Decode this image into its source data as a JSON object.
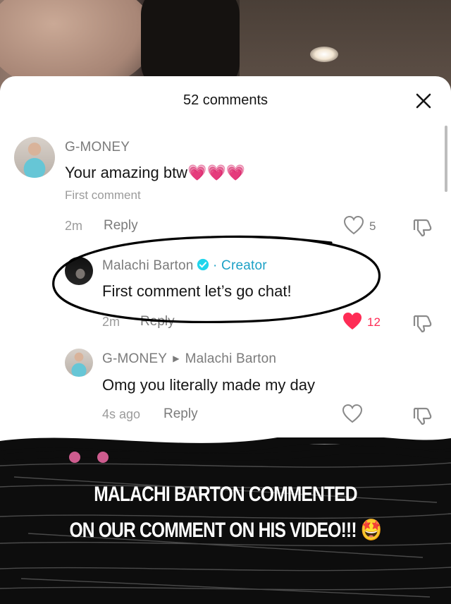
{
  "header": {
    "comments_count": "52 comments"
  },
  "comments": [
    {
      "username": "G-MONEY",
      "text": "Your amazing btw",
      "emoji": "💗💗💗",
      "label": "First comment",
      "time": "2m",
      "reply": "Reply",
      "likes": "5",
      "liked": false
    },
    {
      "username": "Malachi Barton",
      "badge": "· Creator",
      "text": "First comment let’s go chat!",
      "time": "2m",
      "reply": "Reply",
      "likes": "12",
      "liked": true
    },
    {
      "username": "G-MONEY",
      "reply_to": "Malachi Barton",
      "text": "Omg you literally made my day",
      "time": "4s ago",
      "reply": "Reply",
      "liked": false
    }
  ],
  "overlay": {
    "line1": "MALACHI BARTON COMMENTED",
    "line2": "ON OUR COMMENT ON HIS VIDEO!!!",
    "emoji": "🤩"
  },
  "colors": {
    "accent_like": "#fe2c55",
    "creator": "#1da1c6",
    "circle": "#000000"
  }
}
